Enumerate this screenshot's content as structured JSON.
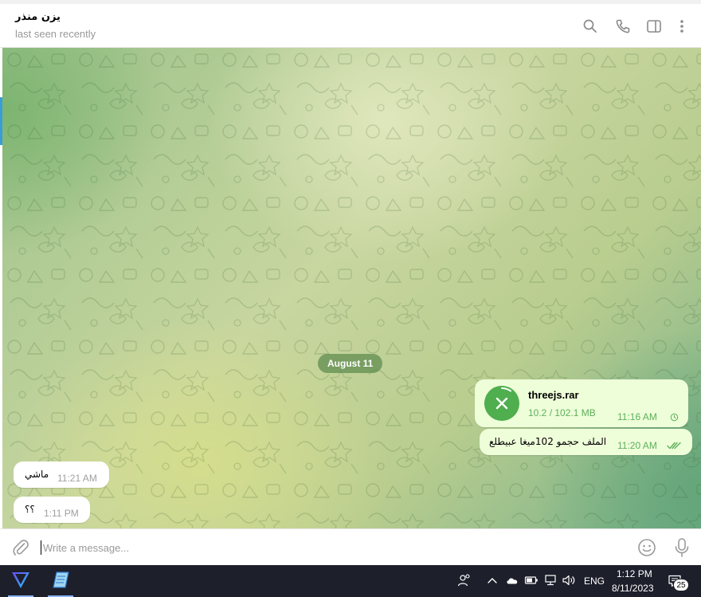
{
  "header": {
    "peer_name": "يزن منذر",
    "peer_status": "last seen recently",
    "icons": [
      "search-icon",
      "phone-icon",
      "sidebar-toggle-icon",
      "more-vertical-icon"
    ]
  },
  "chat": {
    "date_separator": "August 11",
    "outgoing": {
      "file": {
        "name": "threejs.rar",
        "progress": "10.2 / 102.1 MB",
        "progress_fraction": 0.1,
        "time": "11:16 AM",
        "status_icon": "clock-icon",
        "action_icon": "cancel-download-icon"
      },
      "text_message": {
        "text": "الملف حجمو 102ميغا عبيطلع",
        "time": "11:20 AM",
        "status_icon": "double-check-icon"
      }
    },
    "incoming": [
      {
        "text": "ماشي",
        "time": "11:21 AM"
      },
      {
        "text": "؟؟",
        "time": "1:11 PM"
      }
    ],
    "colors": {
      "outgoing_bubble": "#eefed9",
      "accent_green": "#4fae4e",
      "time_green": "#5daf5b"
    }
  },
  "composer": {
    "placeholder": "Write a message...",
    "value": "",
    "icons": [
      "attach-icon",
      "emoji-icon",
      "microphone-icon"
    ]
  },
  "taskbar": {
    "apps": [
      "proton-vpn-icon",
      "notes-app-icon"
    ],
    "language": "ENG",
    "time": "1:12 PM",
    "date": "8/11/2023",
    "notification_count": "25",
    "tray_icons": [
      "people-icon",
      "chevron-up-icon",
      "cloud-icon",
      "battery-icon",
      "network-icon",
      "volume-icon",
      "notification-icon"
    ]
  }
}
